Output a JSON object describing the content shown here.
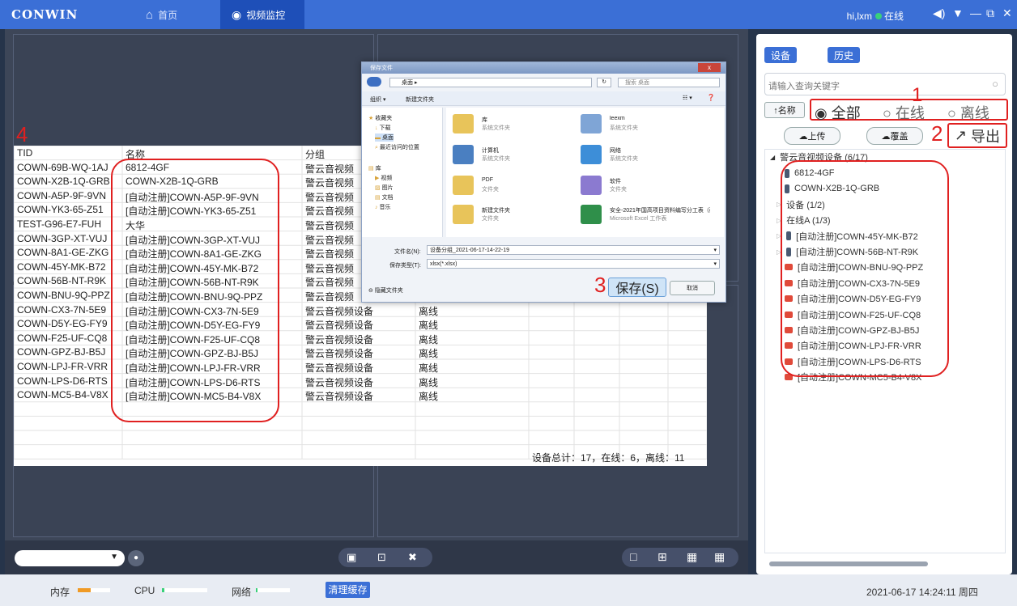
{
  "app": {
    "logo": "CONWIN",
    "nav_home": "首页",
    "nav_video": "视频监控",
    "user": "hi,lxm",
    "status": "在线"
  },
  "colors": {
    "accent": "#3b6fd6",
    "annotation": "#e02020",
    "online": "#3ad17a"
  },
  "annotations": {
    "n1": "1",
    "n2": "2",
    "n3": "3",
    "n4": "4"
  },
  "table": {
    "headers": [
      "TID",
      "名称",
      "分组"
    ],
    "rows": [
      [
        "COWN-69B-WQ-1AJ",
        "6812-4GF",
        "警云音视频",
        ""
      ],
      [
        "COWN-X2B-1Q-GRB",
        "COWN-X2B-1Q-GRB",
        "警云音视频",
        ""
      ],
      [
        "COWN-A5P-9F-9VN",
        "[自动注册]COWN-A5P-9F-9VN",
        "警云音视频",
        ""
      ],
      [
        "COWN-YK3-65-Z51",
        "[自动注册]COWN-YK3-65-Z51",
        "警云音视频",
        ""
      ],
      [
        "TEST-G96-E7-FUH",
        "大华",
        "警云音视频",
        ""
      ],
      [
        "COWN-3GP-XT-VUJ",
        "[自动注册]COWN-3GP-XT-VUJ",
        "警云音视频",
        ""
      ],
      [
        "COWN-8A1-GE-ZKG",
        "[自动注册]COWN-8A1-GE-ZKG",
        "警云音视频",
        ""
      ],
      [
        "COWN-45Y-MK-B72",
        "[自动注册]COWN-45Y-MK-B72",
        "警云音视频",
        ""
      ],
      [
        "COWN-56B-NT-R9K",
        "[自动注册]COWN-56B-NT-R9K",
        "警云音视频",
        ""
      ],
      [
        "COWN-BNU-9Q-PPZ",
        "[自动注册]COWN-BNU-9Q-PPZ",
        "警云音视频",
        ""
      ],
      [
        "COWN-CX3-7N-5E9",
        "[自动注册]COWN-CX3-7N-5E9",
        "警云音视频设备",
        "离线"
      ],
      [
        "COWN-D5Y-EG-FY9",
        "[自动注册]COWN-D5Y-EG-FY9",
        "警云音视频设备",
        "离线"
      ],
      [
        "COWN-F25-UF-CQ8",
        "[自动注册]COWN-F25-UF-CQ8",
        "警云音视频设备",
        "离线"
      ],
      [
        "COWN-GPZ-BJ-B5J",
        "[自动注册]COWN-GPZ-BJ-B5J",
        "警云音视频设备",
        "离线"
      ],
      [
        "COWN-LPJ-FR-VRR",
        "[自动注册]COWN-LPJ-FR-VRR",
        "警云音视频设备",
        "离线"
      ],
      [
        "COWN-LPS-D6-RTS",
        "[自动注册]COWN-LPS-D6-RTS",
        "警云音视频设备",
        "离线"
      ],
      [
        "COWN-MC5-B4-V8X",
        "[自动注册]COWN-MC5-B4-V8X",
        "警云音视频设备",
        "离线"
      ]
    ],
    "summary": "设备总计：17，在线：6，离线：11"
  },
  "dialog": {
    "title": "保存文件",
    "breadcrumb": "桌面 ▸",
    "search_placeholder": "搜索 桌面",
    "organize": "组织 ▾",
    "new_folder": "新建文件夹",
    "nav": [
      "收藏夹",
      "下载",
      "桌面",
      "最近访问的位置",
      "库",
      "视频",
      "图片",
      "文档",
      "音乐"
    ],
    "files": [
      {
        "name": "库",
        "sub": "系统文件夹"
      },
      {
        "name": "leexm",
        "sub": "系统文件夹"
      },
      {
        "name": "计算机",
        "sub": "系统文件夹"
      },
      {
        "name": "网络",
        "sub": "系统文件夹"
      },
      {
        "name": "PDF",
        "sub": "文件夹"
      },
      {
        "name": "软件",
        "sub": "文件夹"
      },
      {
        "name": "新建文件夹",
        "sub": "文件夹"
      },
      {
        "name": "安全-2021年国高项目资料编写分工表（确定）",
        "sub": "Microsoft Excel 工作表"
      }
    ],
    "filename_label": "文件名(N):",
    "filename_value": "设备分组_2021-06-17-14-22-19",
    "filetype_label": "保存类型(T):",
    "filetype_value": "xlsx(*.xlsx)",
    "hide_folders": "隐藏文件夹",
    "save": "保存(S)",
    "cancel": "取消"
  },
  "right": {
    "tab_device": "设备",
    "tab_history": "历史",
    "search_placeholder": "请输入查询关键字",
    "sort_name": "↑名称",
    "filter_all": "全部",
    "filter_online": "在线",
    "filter_offline": "离线",
    "upload": "上传",
    "overwrite": "覆盖",
    "export": "导出",
    "tree": {
      "root": "警云音视频设备 (6/17)",
      "items": [
        {
          "label": "6812-4GF",
          "level": 1,
          "status": "online"
        },
        {
          "label": "COWN-X2B-1Q-GRB",
          "level": 1,
          "status": "online"
        },
        {
          "label": "设备 (1/2)",
          "level": 0,
          "status": "group"
        },
        {
          "label": "在线A (1/3)",
          "level": 0,
          "status": "group"
        },
        {
          "label": "[自动注册]COWN-45Y-MK-B72",
          "level": 1,
          "status": "online"
        },
        {
          "label": "[自动注册]COWN-56B-NT-R9K",
          "level": 1,
          "status": "online"
        },
        {
          "label": "[自动注册]COWN-BNU-9Q-PPZ",
          "level": 1,
          "status": "offline"
        },
        {
          "label": "[自动注册]COWN-CX3-7N-5E9",
          "level": 1,
          "status": "offline"
        },
        {
          "label": "[自动注册]COWN-D5Y-EG-FY9",
          "level": 1,
          "status": "offline"
        },
        {
          "label": "[自动注册]COWN-F25-UF-CQ8",
          "level": 1,
          "status": "offline"
        },
        {
          "label": "[自动注册]COWN-GPZ-BJ-B5J",
          "level": 1,
          "status": "offline"
        },
        {
          "label": "[自动注册]COWN-LPJ-FR-VRR",
          "level": 1,
          "status": "offline"
        },
        {
          "label": "[自动注册]COWN-LPS-D6-RTS",
          "level": 1,
          "status": "offline"
        },
        {
          "label": "[自动注册]COWN-MC5-B4-V8X",
          "level": 1,
          "status": "offline"
        }
      ]
    }
  },
  "statusbar": {
    "mem": "内存",
    "mem_level": 0.4,
    "cpu": "CPU",
    "cpu_level": 0.05,
    "net": "网络",
    "net_level": 0.05,
    "clear_cache": "清理缓存",
    "datetime": "2021-06-17 14:24:11 周四"
  }
}
